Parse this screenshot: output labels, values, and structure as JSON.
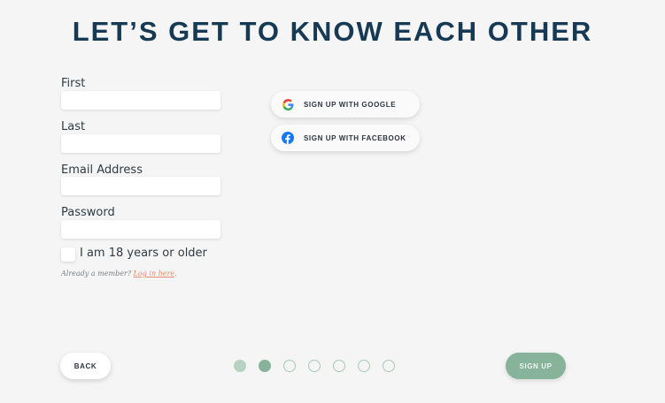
{
  "title": "LET’S GET TO KNOW EACH OTHER",
  "form": {
    "first_label": "First",
    "last_label": "Last",
    "email_label": "Email Address",
    "password_label": "Password",
    "first_value": "",
    "last_value": "",
    "email_value": "",
    "password_value": "",
    "age_checkbox_label": "I am 18 years or older",
    "age_checked": false,
    "member_text": "Already a member?",
    "login_link": "Log in here",
    "member_suffix": "."
  },
  "social": {
    "google_label": "SIGN UP WITH GOOGLE",
    "google_icon": "google-icon",
    "facebook_label": "SIGN UP WITH FACEBOOK",
    "facebook_icon": "facebook-icon"
  },
  "nav": {
    "back_label": "BACK",
    "signup_label": "SIGN UP",
    "steps_total": 7,
    "steps_completed": 1,
    "current_step": 2
  },
  "colors": {
    "title": "#173a54",
    "accent_green": "#87b39a",
    "link": "#e58a6c",
    "facebook": "#1877f2"
  }
}
